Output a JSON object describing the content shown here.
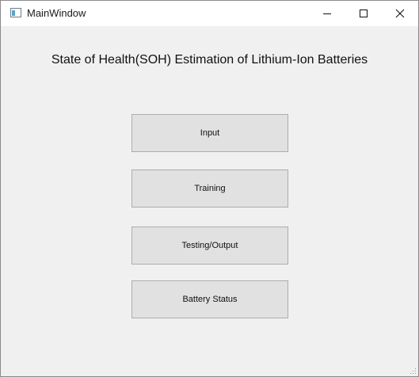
{
  "window": {
    "title": "MainWindow",
    "title_icon": "qt-window-icon",
    "controls": {
      "minimize_icon": "minimize-icon",
      "maximize_icon": "maximize-icon",
      "close_icon": "close-icon"
    }
  },
  "main": {
    "heading": "State of Health(SOH) Estimation of Lithium-Ion Batteries",
    "buttons": [
      {
        "label": "Input"
      },
      {
        "label": "Training"
      },
      {
        "label": "Testing/Output"
      },
      {
        "label": "Battery Status"
      }
    ]
  },
  "colors": {
    "window_bg": "#f0f0f0",
    "titlebar_bg": "#ffffff",
    "button_bg": "#e1e1e1",
    "button_border": "#adadad"
  }
}
